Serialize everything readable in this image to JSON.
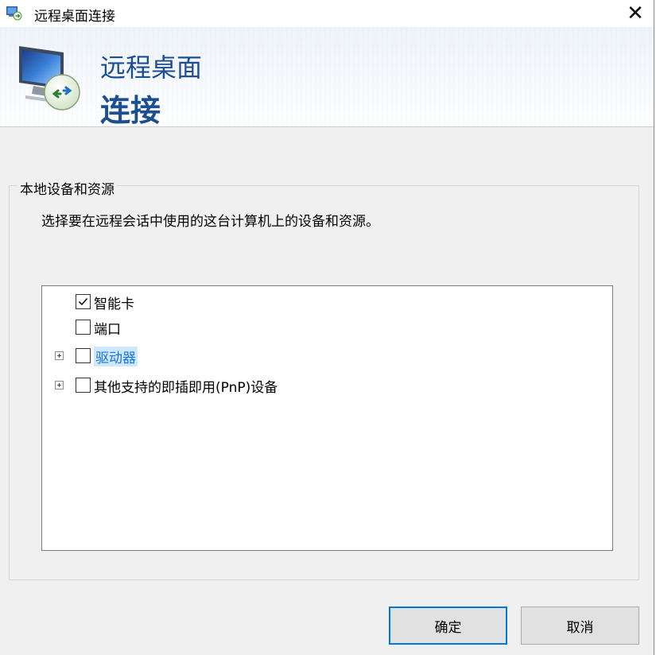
{
  "window": {
    "title": "远程桌面连接",
    "close_glyph": "✕"
  },
  "banner": {
    "line1": "远程桌面",
    "line2": "连接",
    "icon": "remote-desktop-monitor-icon"
  },
  "group": {
    "legend": "本地设备和资源",
    "description": "选择要在远程会话中使用的这台计算机上的设备和资源。"
  },
  "tree": {
    "items": [
      {
        "label": "智能卡",
        "checked": true,
        "expandable": false,
        "selected": false
      },
      {
        "label": "端口",
        "checked": false,
        "expandable": false,
        "selected": false
      },
      {
        "label": "驱动器",
        "checked": false,
        "expandable": true,
        "selected": true
      },
      {
        "label": "其他支持的即插即用(PnP)设备",
        "checked": false,
        "expandable": true,
        "selected": false
      }
    ]
  },
  "buttons": {
    "ok_label": "确定",
    "cancel_label": "取消"
  },
  "colors": {
    "accent": "#0078d7",
    "banner_text": "#1b4f92",
    "selection_bg": "#cde8ff"
  }
}
